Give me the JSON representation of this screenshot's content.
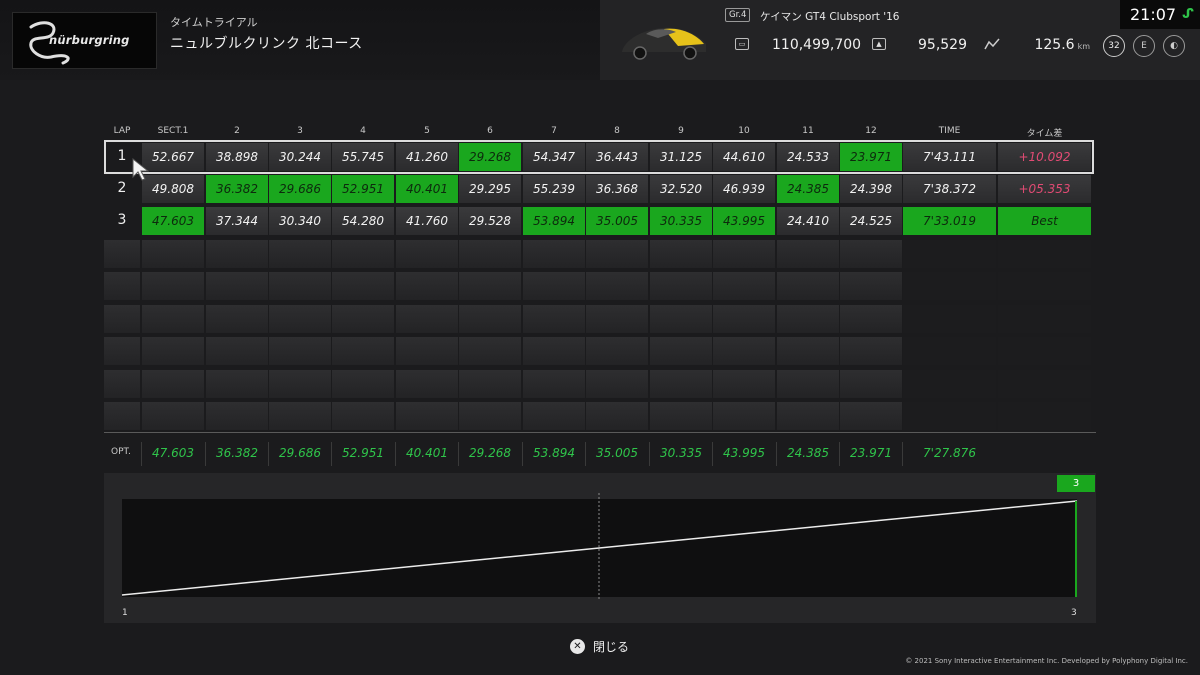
{
  "header": {
    "logo_text": "nürburgring",
    "mode": "タイムトライアル",
    "course": "ニュルブルクリンク 北コース",
    "gr_class": "Gr.4",
    "car": "ケイマン GT4 Clubsport '16",
    "credits": "110,499,700",
    "mileage_points": "95,529",
    "distance": "125.6",
    "distance_unit": "km",
    "level": "32",
    "clock": "21:07",
    "icons": [
      "credits-icon",
      "mileage-icon",
      "distance-icon",
      "level-icon",
      "driver-rating-icon",
      "sportsmanship-icon",
      "network-status-icon"
    ]
  },
  "table": {
    "headers": [
      "LAP",
      "SECT.1",
      "2",
      "3",
      "4",
      "5",
      "6",
      "7",
      "8",
      "9",
      "10",
      "11",
      "12",
      "TIME",
      "タイム差"
    ],
    "rows": [
      {
        "lap": "1",
        "sectors": [
          "52.667",
          "38.898",
          "30.244",
          "55.745",
          "41.260",
          "29.268",
          "54.347",
          "36.443",
          "31.125",
          "44.610",
          "24.533",
          "23.971"
        ],
        "time": "7'43.111",
        "diff": "+10.092"
      },
      {
        "lap": "2",
        "sectors": [
          "49.808",
          "36.382",
          "29.686",
          "52.951",
          "40.401",
          "29.295",
          "55.239",
          "36.368",
          "32.520",
          "46.939",
          "24.385",
          "24.398"
        ],
        "time": "7'38.372",
        "diff": "+05.353"
      },
      {
        "lap": "3",
        "sectors": [
          "47.603",
          "37.344",
          "30.340",
          "54.280",
          "41.760",
          "29.528",
          "53.894",
          "35.005",
          "30.335",
          "43.995",
          "24.410",
          "24.525"
        ],
        "time": "7'33.019",
        "diff": "Best"
      }
    ],
    "opt_label": "OPT.",
    "opt": [
      "47.603",
      "36.382",
      "29.686",
      "52.951",
      "40.401",
      "29.268",
      "53.894",
      "35.005",
      "30.335",
      "43.995",
      "24.385",
      "23.971"
    ],
    "opt_time": "7'27.876",
    "selected_lap": "1"
  },
  "graph": {
    "flag_label": "3",
    "axis_start": "1",
    "axis_end": "3"
  },
  "footer": {
    "close_label": "閉じる",
    "close_icon": "cross-button-icon",
    "copyright": "© 2021 Sony Interactive Entertainment Inc. Developed by Polyphony Digital Inc."
  },
  "colors": {
    "best_green": "#1aa71e",
    "opt_green": "#2fc44a",
    "diff_pink": "#e24b74"
  }
}
